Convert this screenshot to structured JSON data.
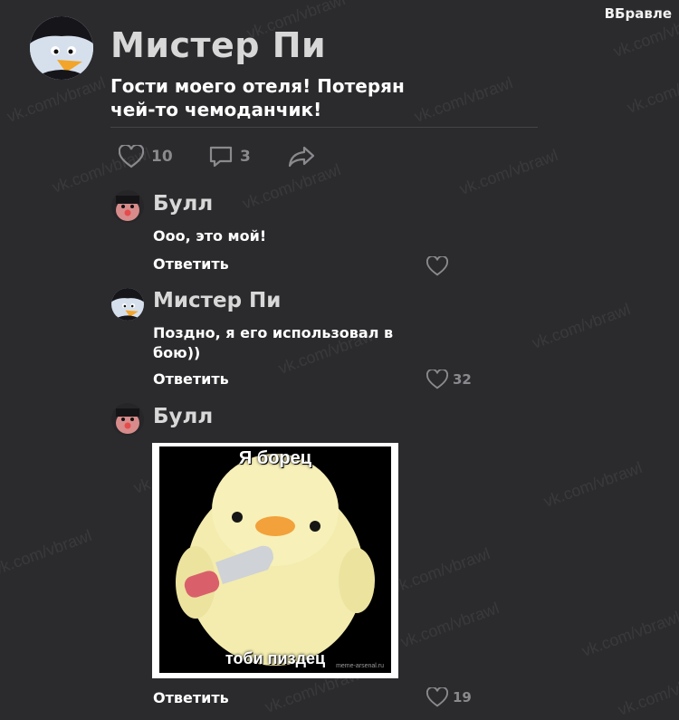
{
  "brand": "ВБравле",
  "watermark": "vk.com/vbrawl",
  "post": {
    "author": "Мистер Пи",
    "text": "Гости моего отеля! Потерян чей-то чемоданчик!",
    "likes": "10",
    "comments": "3"
  },
  "comments": [
    {
      "author": "Булл",
      "text": "Ооо, это мой!",
      "reply_label": "Ответить",
      "likes": ""
    },
    {
      "author": "Мистер Пи",
      "text": "Поздно, я его использовал в бою))",
      "reply_label": "Ответить",
      "likes": "32"
    },
    {
      "author": "Булл",
      "reply_label": "Ответить",
      "likes": "19",
      "meme": {
        "top_caption": "Я борец",
        "bottom_caption": "тоби пиздец",
        "credit": "meme-arsenal.ru"
      }
    }
  ]
}
